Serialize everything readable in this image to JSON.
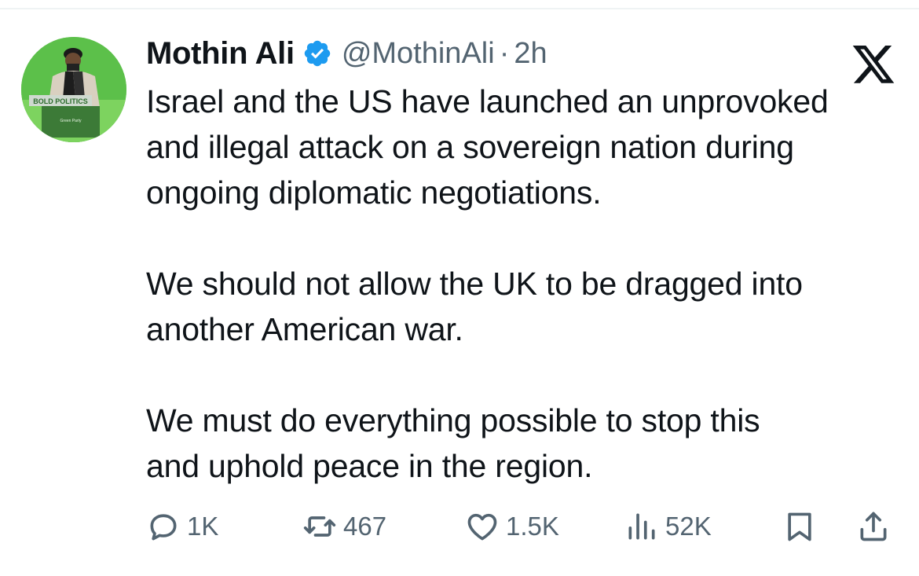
{
  "author": {
    "name": "Mothin Ali",
    "handle": "@MothinAli",
    "separator": "·",
    "time": "2h",
    "avatar_sign_text": "BOLD POLITICS",
    "avatar_podium_text": "Green Party"
  },
  "tweet": {
    "paragraphs": [
      "Israel and the US have launched an unprovoked\nand illegal attack on a sovereign nation during\nongoing diplomatic negotiations.",
      "We should not allow the UK to be dragged into\nanother American war.",
      "We must do everything possible to stop this\nand uphold peace in the region."
    ]
  },
  "actions": {
    "replies": "1K",
    "reposts": "467",
    "likes": "1.5K",
    "views": "52K"
  },
  "icons": {
    "verified": "verified-badge-icon",
    "platform": "x-logo-icon",
    "reply": "reply-icon",
    "repost": "repost-icon",
    "like": "heart-icon",
    "views": "views-icon",
    "bookmark": "bookmark-icon",
    "share": "share-icon"
  },
  "colors": {
    "text": "#0f1419",
    "secondary": "#536471",
    "verified_blue": "#1d9bf0",
    "avatar_bg": "#5cc04a"
  }
}
